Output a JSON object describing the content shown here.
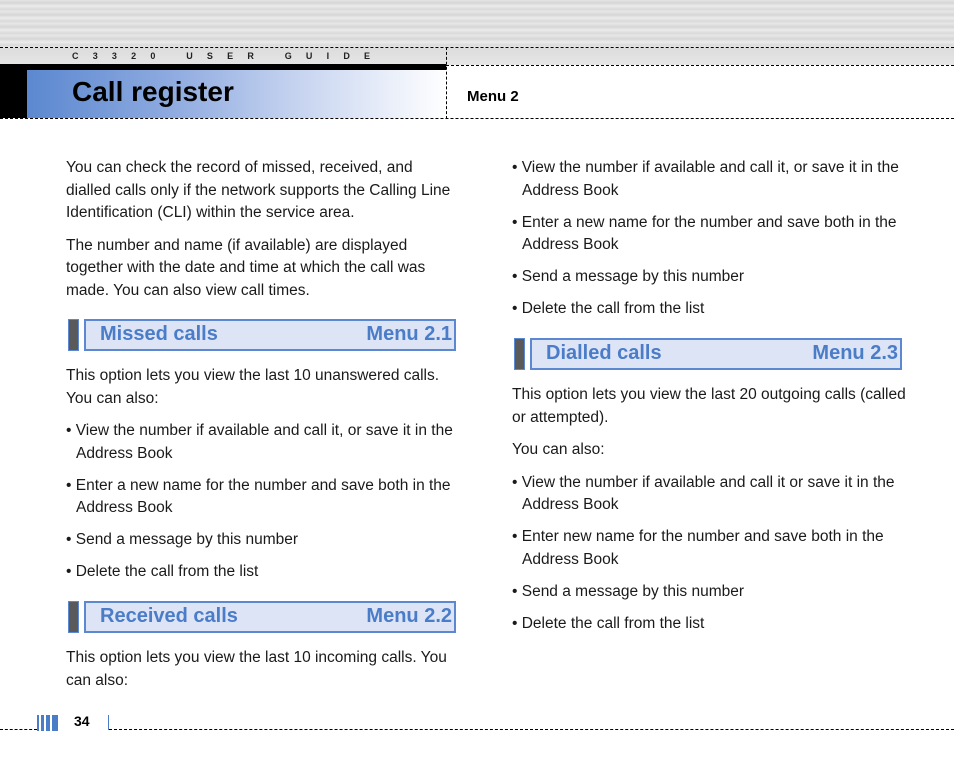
{
  "header": {
    "guide_label": "C3320 USER GUIDE",
    "title": "Call register",
    "menu": "Menu 2"
  },
  "left_column": {
    "intro": [
      "You can check the record of missed, received, and dialled calls only if the network supports the Calling Line Identification (CLI) within the service area.",
      "The number and name (if available) are displayed together with the date and time at which the call was made. You can also view call times."
    ],
    "missed": {
      "title": "Missed calls",
      "menu": "Menu 2.1",
      "description": "This option lets you view the last 10 unanswered calls. You can also:",
      "bullets": [
        "• View the number if available and call it, or save it in the Address Book",
        "• Enter a new name for the number and save both in the Address Book",
        "• Send a message by this number",
        "• Delete the call from the list"
      ]
    },
    "received": {
      "title": "Received calls",
      "menu": "Menu 2.2",
      "description": "This option lets you view the last 10 incoming calls. You can also:"
    }
  },
  "right_column": {
    "received_bullets": [
      "• View the number if available and call it, or save it in the Address Book",
      "• Enter a new name for the number and save both in the Address Book",
      "• Send a message by this number",
      "• Delete the call from the list"
    ],
    "dialled": {
      "title": "Dialled calls",
      "menu": "Menu 2.3",
      "description": "This option lets you view the last 20 outgoing calls (called or attempted).",
      "also": "You can also:",
      "bullets": [
        "• View the number if available and call it or save it in the Address Book",
        "• Enter new name for the number and save both in the Address Book",
        "• Send a message by this number",
        "• Delete the call from the list"
      ]
    }
  },
  "footer": {
    "page_number": "34"
  },
  "colors": {
    "accent_blue": "#4a7cc7",
    "section_bg": "#dce4f6",
    "marker_gray": "#5a5a5a"
  }
}
